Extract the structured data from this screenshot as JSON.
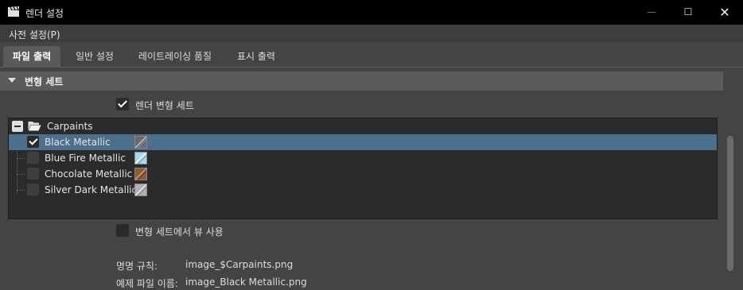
{
  "window": {
    "title": "렌더 설정",
    "minimize_glyph": "—",
    "maximize_glyph": "☐",
    "close_glyph": "✕",
    "app_icon": "clapperboard-icon"
  },
  "menu": {
    "presets": "사전 설정(P)"
  },
  "tabs": [
    {
      "label": "파일 출력",
      "active": true
    },
    {
      "label": "일반 설정",
      "active": false
    },
    {
      "label": "레이트레이싱 품질",
      "active": false
    },
    {
      "label": "표시 출력",
      "active": false
    }
  ],
  "section": {
    "title": "변형 세트",
    "expanded": true
  },
  "render_variant_set": {
    "label": "렌더 변형 세트",
    "checked": true
  },
  "tree": {
    "root": {
      "label": "Carpaints",
      "icon": "folder-open-icon",
      "expanded": true
    },
    "items": [
      {
        "label": "Black Metallic",
        "checked": true,
        "selected": true,
        "swatch": "#6a6a6a"
      },
      {
        "label": "Blue Fire Metallic",
        "checked": false,
        "selected": false,
        "swatch": "#a9d6e8"
      },
      {
        "label": "Chocolate Metallic",
        "checked": false,
        "selected": false,
        "swatch": "#8a5a3c"
      },
      {
        "label": "Silver Dark Metallic",
        "checked": false,
        "selected": false,
        "swatch": "#b0b0b0"
      }
    ]
  },
  "use_view": {
    "label": "변형 세트에서 뷰 사용",
    "checked": false
  },
  "naming": {
    "rule_label": "명명 규칙:",
    "rule_value": "image_$Carpaints.png",
    "example_label": "예제 파일 이름:",
    "example_value": "image_Black Metallic.png"
  },
  "colors": {
    "selection": "#4d6f8e",
    "background": "#444444"
  }
}
